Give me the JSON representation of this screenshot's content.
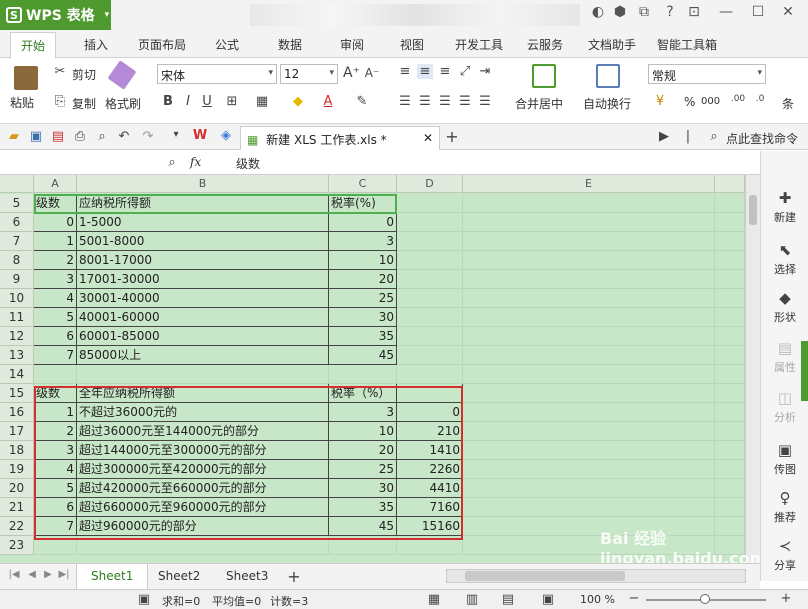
{
  "app": {
    "name": "WPS 表格",
    "logo": "S"
  },
  "menu_tabs": [
    "开始",
    "插入",
    "页面布局",
    "公式",
    "数据",
    "审阅",
    "视图",
    "开发工具",
    "云服务",
    "文档助手",
    "智能工具箱"
  ],
  "ribbon": {
    "paste": "粘贴",
    "cut": "剪切",
    "copy": "复制",
    "format_painter": "格式刷",
    "font_name": "宋体",
    "font_size": "12",
    "bold": "B",
    "italic": "I",
    "underline": "U",
    "merge": "合并居中",
    "wrap": "自动换行",
    "number_format": "常规",
    "percent": "%",
    "thousand": "000",
    "more": "条"
  },
  "doc_tab": {
    "title": "新建 XLS 工作表.xls *"
  },
  "find_cmd": "点此查找命令",
  "formula_bar": {
    "cell_ref": "A5",
    "fx": "fx",
    "value": "级数"
  },
  "columns": [
    "A",
    "B",
    "C",
    "D",
    "E"
  ],
  "rows": [
    {
      "n": "5",
      "a": "级数",
      "b": "应纳税所得额",
      "c": "税率(%)",
      "d": ""
    },
    {
      "n": "6",
      "a": "0",
      "b": "1-5000",
      "c": "0",
      "d": ""
    },
    {
      "n": "7",
      "a": "1",
      "b": "5001-8000",
      "c": "3",
      "d": ""
    },
    {
      "n": "8",
      "a": "2",
      "b": "8001-17000",
      "c": "10",
      "d": ""
    },
    {
      "n": "9",
      "a": "3",
      "b": "17001-30000",
      "c": "20",
      "d": ""
    },
    {
      "n": "10",
      "a": "4",
      "b": "30001-40000",
      "c": "25",
      "d": ""
    },
    {
      "n": "11",
      "a": "5",
      "b": "40001-60000",
      "c": "30",
      "d": ""
    },
    {
      "n": "12",
      "a": "6",
      "b": "60001-85000",
      "c": "35",
      "d": ""
    },
    {
      "n": "13",
      "a": "7",
      "b": "85000以上",
      "c": "45",
      "d": ""
    },
    {
      "n": "14",
      "a": "",
      "b": "",
      "c": "",
      "d": ""
    },
    {
      "n": "15",
      "a": "级数",
      "b": "全年应纳税所得额",
      "c": "税率（%）",
      "d": ""
    },
    {
      "n": "16",
      "a": "1",
      "b": "不超过36000元的",
      "c": "3",
      "d": "0"
    },
    {
      "n": "17",
      "a": "2",
      "b": "超过36000元至144000元的部分",
      "c": "10",
      "d": "210"
    },
    {
      "n": "18",
      "a": "3",
      "b": "超过144000元至300000元的部分",
      "c": "20",
      "d": "1410"
    },
    {
      "n": "19",
      "a": "4",
      "b": "超过300000元至420000元的部分",
      "c": "25",
      "d": "2260"
    },
    {
      "n": "20",
      "a": "5",
      "b": "超过420000元至660000元的部分",
      "c": "30",
      "d": "4410"
    },
    {
      "n": "21",
      "a": "6",
      "b": "超过660000元至960000元的部分",
      "c": "35",
      "d": "7160"
    },
    {
      "n": "22",
      "a": "7",
      "b": "超过960000元的部分",
      "c": "45",
      "d": "15160"
    },
    {
      "n": "23",
      "a": "",
      "b": "",
      "c": "",
      "d": ""
    }
  ],
  "side_panel": [
    "新建",
    "选择",
    "形状",
    "属性",
    "分析",
    "传图",
    "推荐",
    "分享"
  ],
  "sheets": [
    "Sheet1",
    "Sheet2",
    "Sheet3"
  ],
  "status": {
    "sum": "求和=0",
    "avg": "平均值=0",
    "count": "计数=3",
    "zoom": "100 %"
  },
  "watermark": "Bai 经验 jingyan.baidu.com",
  "colors": {
    "accent": "#4e9a2e",
    "grid_bg": "#c8e6c8",
    "green_box": "#4caf50",
    "red_box": "#d32f2f"
  }
}
